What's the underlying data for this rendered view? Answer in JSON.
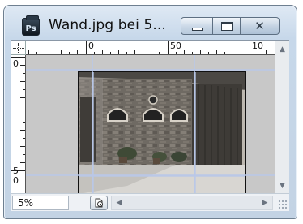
{
  "window": {
    "title": "Wand.jpg bei 5...",
    "app_icon_text": "Ps",
    "controls": {
      "minimize_label": "minimize",
      "maximize_label": "maximize",
      "close_label": "close",
      "close_glyph": "✕"
    }
  },
  "rulers": {
    "horizontal": [
      "0",
      "50",
      "10"
    ],
    "vertical": [
      "0",
      "5",
      "0"
    ]
  },
  "document": {
    "image_name": "Wand.jpg",
    "content": "photo of stone building wall with arched windows"
  },
  "scrollbars": {
    "up_arrow": "▲",
    "down_arrow": "▼",
    "left_arrow": "◀",
    "right_arrow": "▶"
  },
  "status": {
    "zoom": "5%"
  },
  "colors": {
    "chrome": "#c7d8ea",
    "canvas": "#c6c6c6",
    "guide": "#b9c7e8"
  }
}
